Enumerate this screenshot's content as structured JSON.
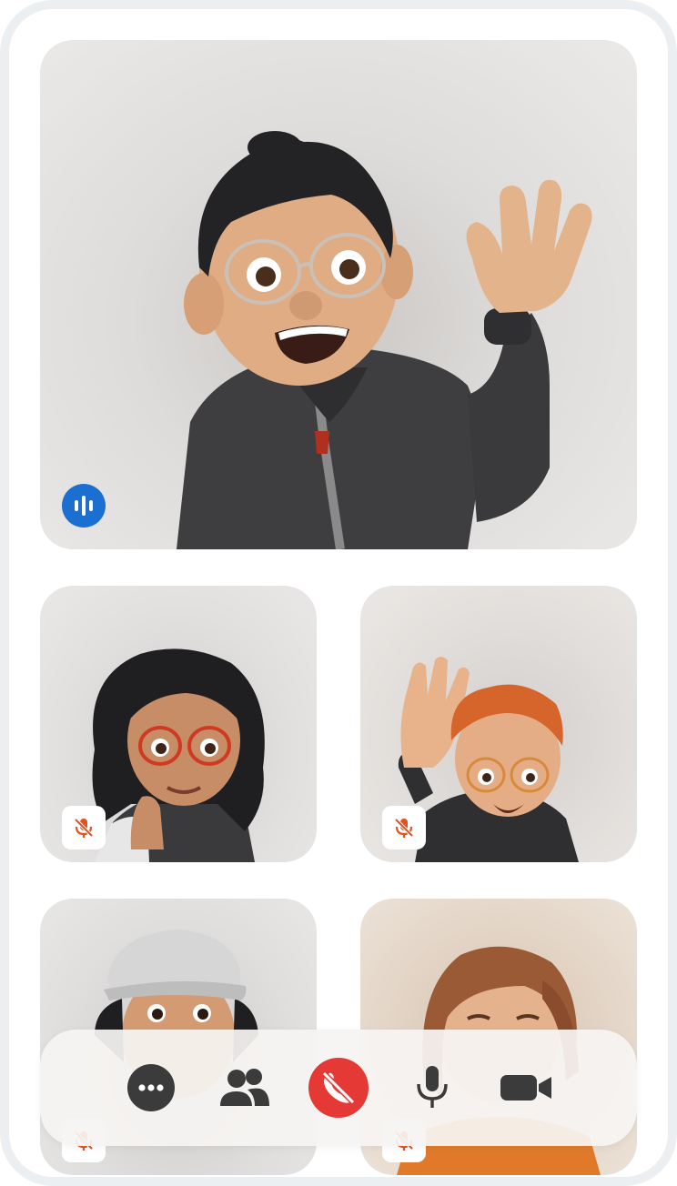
{
  "call": {
    "participants": [
      {
        "id": "main",
        "avatar": "memoji-man-waving-hoodie-icon",
        "status": "speaking",
        "status_icon": "audio-waveform-icon"
      },
      {
        "id": "p2",
        "avatar": "memoji-woman-red-glasses-icon",
        "status": "muted",
        "status_icon": "mic-off-icon"
      },
      {
        "id": "p3",
        "avatar": "memoji-redhead-waving-icon",
        "status": "muted",
        "status_icon": "mic-off-icon"
      },
      {
        "id": "p4",
        "avatar": "memoji-girl-white-cap-icon",
        "status": "muted",
        "status_icon": "mic-off-icon"
      },
      {
        "id": "p5",
        "avatar": "memoji-brown-hair-orange-shirt-icon",
        "status": "muted",
        "status_icon": "mic-off-icon"
      }
    ]
  },
  "controls": {
    "more": {
      "icon": "more-options-icon"
    },
    "participants": {
      "icon": "people-icon"
    },
    "end_call": {
      "icon": "end-call-icon"
    },
    "microphone": {
      "icon": "microphone-icon"
    },
    "camera": {
      "icon": "video-camera-icon"
    }
  },
  "colors": {
    "speaking_accent": "#1a6fd0",
    "muted_accent": "#e8501e",
    "end_call_red": "#e53935",
    "control_icon": "#3b3b3b",
    "frame_border": "#eceff2"
  }
}
